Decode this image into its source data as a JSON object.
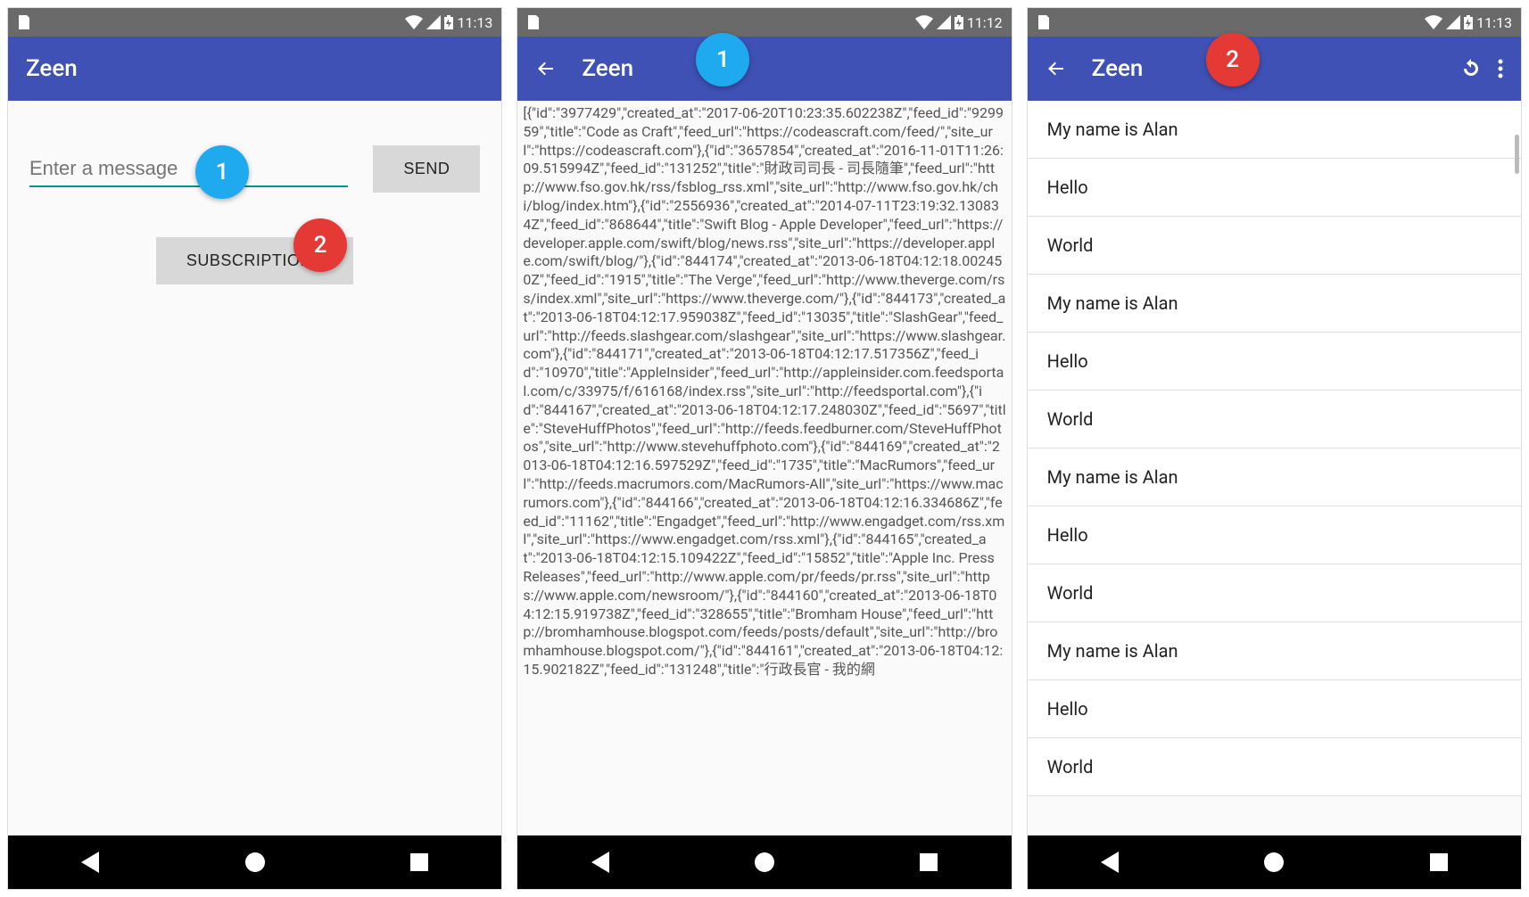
{
  "status": {
    "time_s1": "11:13",
    "time_s2": "11:12",
    "time_s3": "11:13"
  },
  "app_title": "Zeen",
  "screen1": {
    "input_placeholder": "Enter a message",
    "send_label": "SEND",
    "subs_label": "SUBSCRIPTIONS",
    "callout1": "1",
    "callout2": "2"
  },
  "screen2": {
    "callout1": "1",
    "json_body": "[{\"id\":\"3977429\",\"created_at\":\"2017-06-20T10:23:35.602238Z\",\"feed_id\":\"929959\",\"title\":\"Code as Craft\",\"feed_url\":\"https://codeascraft.com/feed/\",\"site_url\":\"https://codeascraft.com\"},{\"id\":\"3657854\",\"created_at\":\"2016-11-01T11:26:09.515994Z\",\"feed_id\":\"131252\",\"title\":\"財政司司長 - 司長隨筆\",\"feed_url\":\"http://www.fso.gov.hk/rss/fsblog_rss.xml\",\"site_url\":\"http://www.fso.gov.hk/chi/blog/index.htm\"},{\"id\":\"2556936\",\"created_at\":\"2014-07-11T23:19:32.130834Z\",\"feed_id\":\"868644\",\"title\":\"Swift Blog - Apple Developer\",\"feed_url\":\"https://developer.apple.com/swift/blog/news.rss\",\"site_url\":\"https://developer.apple.com/swift/blog/\"},{\"id\":\"844174\",\"created_at\":\"2013-06-18T04:12:18.002450Z\",\"feed_id\":\"1915\",\"title\":\"The Verge\",\"feed_url\":\"http://www.theverge.com/rss/index.xml\",\"site_url\":\"https://www.theverge.com/\"},{\"id\":\"844173\",\"created_at\":\"2013-06-18T04:12:17.959038Z\",\"feed_id\":\"13035\",\"title\":\"SlashGear\",\"feed_url\":\"http://feeds.slashgear.com/slashgear\",\"site_url\":\"https://www.slashgear.com\"},{\"id\":\"844171\",\"created_at\":\"2013-06-18T04:12:17.517356Z\",\"feed_id\":\"10970\",\"title\":\"AppleInsider\",\"feed_url\":\"http://appleinsider.com.feedsportal.com/c/33975/f/616168/index.rss\",\"site_url\":\"http://feedsportal.com\"},{\"id\":\"844167\",\"created_at\":\"2013-06-18T04:12:17.248030Z\",\"feed_id\":\"5697\",\"title\":\"SteveHuffPhotos\",\"feed_url\":\"http://feeds.feedburner.com/SteveHuffPhotos\",\"site_url\":\"http://www.stevehuffphoto.com\"},{\"id\":\"844169\",\"created_at\":\"2013-06-18T04:12:16.597529Z\",\"feed_id\":\"1735\",\"title\":\"MacRumors\",\"feed_url\":\"http://feeds.macrumors.com/MacRumors-All\",\"site_url\":\"https://www.macrumors.com\"},{\"id\":\"844166\",\"created_at\":\"2013-06-18T04:12:16.334686Z\",\"feed_id\":\"11162\",\"title\":\"Engadget\",\"feed_url\":\"http://www.engadget.com/rss.xml\",\"site_url\":\"https://www.engadget.com/rss.xml\"},{\"id\":\"844165\",\"created_at\":\"2013-06-18T04:12:15.109422Z\",\"feed_id\":\"15852\",\"title\":\"Apple Inc. Press Releases\",\"feed_url\":\"http://www.apple.com/pr/feeds/pr.rss\",\"site_url\":\"https://www.apple.com/newsroom/\"},{\"id\":\"844160\",\"created_at\":\"2013-06-18T04:12:15.919738Z\",\"feed_id\":\"328655\",\"title\":\"Bromham House\",\"feed_url\":\"http://bromhamhouse.blogspot.com/feeds/posts/default\",\"site_url\":\"http://bromhamhouse.blogspot.com/\"},{\"id\":\"844161\",\"created_at\":\"2013-06-18T04:12:15.902182Z\",\"feed_id\":\"131248\",\"title\":\"行政長官 - 我的網"
  },
  "screen3": {
    "callout1": "2",
    "items": [
      "My name is Alan",
      "Hello",
      "World",
      "My name is Alan",
      "Hello",
      "World",
      "My name is Alan",
      "Hello",
      "World",
      "My name is Alan",
      "Hello",
      "World"
    ]
  }
}
